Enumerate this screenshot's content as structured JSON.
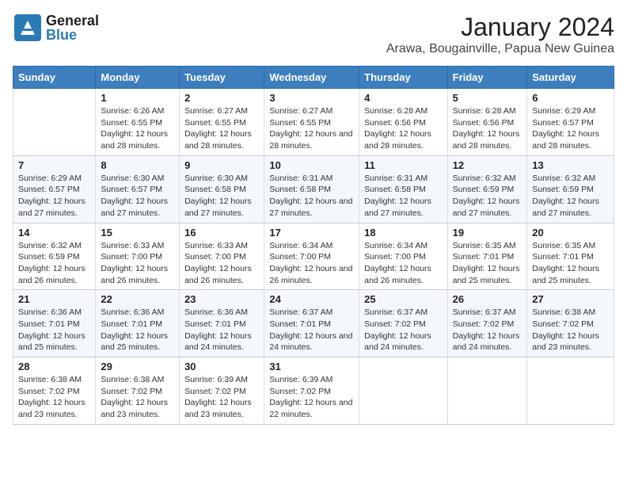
{
  "logo": {
    "general": "General",
    "blue": "Blue"
  },
  "title": "January 2024",
  "subtitle": "Arawa, Bougainville, Papua New Guinea",
  "days_of_week": [
    "Sunday",
    "Monday",
    "Tuesday",
    "Wednesday",
    "Thursday",
    "Friday",
    "Saturday"
  ],
  "weeks": [
    [
      {
        "day": "",
        "info": ""
      },
      {
        "day": "1",
        "info": "Sunrise: 6:26 AM\nSunset: 6:55 PM\nDaylight: 12 hours and 28 minutes."
      },
      {
        "day": "2",
        "info": "Sunrise: 6:27 AM\nSunset: 6:55 PM\nDaylight: 12 hours and 28 minutes."
      },
      {
        "day": "3",
        "info": "Sunrise: 6:27 AM\nSunset: 6:55 PM\nDaylight: 12 hours and 28 minutes."
      },
      {
        "day": "4",
        "info": "Sunrise: 6:28 AM\nSunset: 6:56 PM\nDaylight: 12 hours and 28 minutes."
      },
      {
        "day": "5",
        "info": "Sunrise: 6:28 AM\nSunset: 6:56 PM\nDaylight: 12 hours and 28 minutes."
      },
      {
        "day": "6",
        "info": "Sunrise: 6:29 AM\nSunset: 6:57 PM\nDaylight: 12 hours and 28 minutes."
      }
    ],
    [
      {
        "day": "7",
        "info": "Sunrise: 6:29 AM\nSunset: 6:57 PM\nDaylight: 12 hours and 27 minutes."
      },
      {
        "day": "8",
        "info": "Sunrise: 6:30 AM\nSunset: 6:57 PM\nDaylight: 12 hours and 27 minutes."
      },
      {
        "day": "9",
        "info": "Sunrise: 6:30 AM\nSunset: 6:58 PM\nDaylight: 12 hours and 27 minutes."
      },
      {
        "day": "10",
        "info": "Sunrise: 6:31 AM\nSunset: 6:58 PM\nDaylight: 12 hours and 27 minutes."
      },
      {
        "day": "11",
        "info": "Sunrise: 6:31 AM\nSunset: 6:58 PM\nDaylight: 12 hours and 27 minutes."
      },
      {
        "day": "12",
        "info": "Sunrise: 6:32 AM\nSunset: 6:59 PM\nDaylight: 12 hours and 27 minutes."
      },
      {
        "day": "13",
        "info": "Sunrise: 6:32 AM\nSunset: 6:59 PM\nDaylight: 12 hours and 27 minutes."
      }
    ],
    [
      {
        "day": "14",
        "info": "Sunrise: 6:32 AM\nSunset: 6:59 PM\nDaylight: 12 hours and 26 minutes."
      },
      {
        "day": "15",
        "info": "Sunrise: 6:33 AM\nSunset: 7:00 PM\nDaylight: 12 hours and 26 minutes."
      },
      {
        "day": "16",
        "info": "Sunrise: 6:33 AM\nSunset: 7:00 PM\nDaylight: 12 hours and 26 minutes."
      },
      {
        "day": "17",
        "info": "Sunrise: 6:34 AM\nSunset: 7:00 PM\nDaylight: 12 hours and 26 minutes."
      },
      {
        "day": "18",
        "info": "Sunrise: 6:34 AM\nSunset: 7:00 PM\nDaylight: 12 hours and 26 minutes."
      },
      {
        "day": "19",
        "info": "Sunrise: 6:35 AM\nSunset: 7:01 PM\nDaylight: 12 hours and 25 minutes."
      },
      {
        "day": "20",
        "info": "Sunrise: 6:35 AM\nSunset: 7:01 PM\nDaylight: 12 hours and 25 minutes."
      }
    ],
    [
      {
        "day": "21",
        "info": "Sunrise: 6:36 AM\nSunset: 7:01 PM\nDaylight: 12 hours and 25 minutes."
      },
      {
        "day": "22",
        "info": "Sunrise: 6:36 AM\nSunset: 7:01 PM\nDaylight: 12 hours and 25 minutes."
      },
      {
        "day": "23",
        "info": "Sunrise: 6:36 AM\nSunset: 7:01 PM\nDaylight: 12 hours and 24 minutes."
      },
      {
        "day": "24",
        "info": "Sunrise: 6:37 AM\nSunset: 7:01 PM\nDaylight: 12 hours and 24 minutes."
      },
      {
        "day": "25",
        "info": "Sunrise: 6:37 AM\nSunset: 7:02 PM\nDaylight: 12 hours and 24 minutes."
      },
      {
        "day": "26",
        "info": "Sunrise: 6:37 AM\nSunset: 7:02 PM\nDaylight: 12 hours and 24 minutes."
      },
      {
        "day": "27",
        "info": "Sunrise: 6:38 AM\nSunset: 7:02 PM\nDaylight: 12 hours and 23 minutes."
      }
    ],
    [
      {
        "day": "28",
        "info": "Sunrise: 6:38 AM\nSunset: 7:02 PM\nDaylight: 12 hours and 23 minutes."
      },
      {
        "day": "29",
        "info": "Sunrise: 6:38 AM\nSunset: 7:02 PM\nDaylight: 12 hours and 23 minutes."
      },
      {
        "day": "30",
        "info": "Sunrise: 6:39 AM\nSunset: 7:02 PM\nDaylight: 12 hours and 23 minutes."
      },
      {
        "day": "31",
        "info": "Sunrise: 6:39 AM\nSunset: 7:02 PM\nDaylight: 12 hours and 22 minutes."
      },
      {
        "day": "",
        "info": ""
      },
      {
        "day": "",
        "info": ""
      },
      {
        "day": "",
        "info": ""
      }
    ]
  ]
}
